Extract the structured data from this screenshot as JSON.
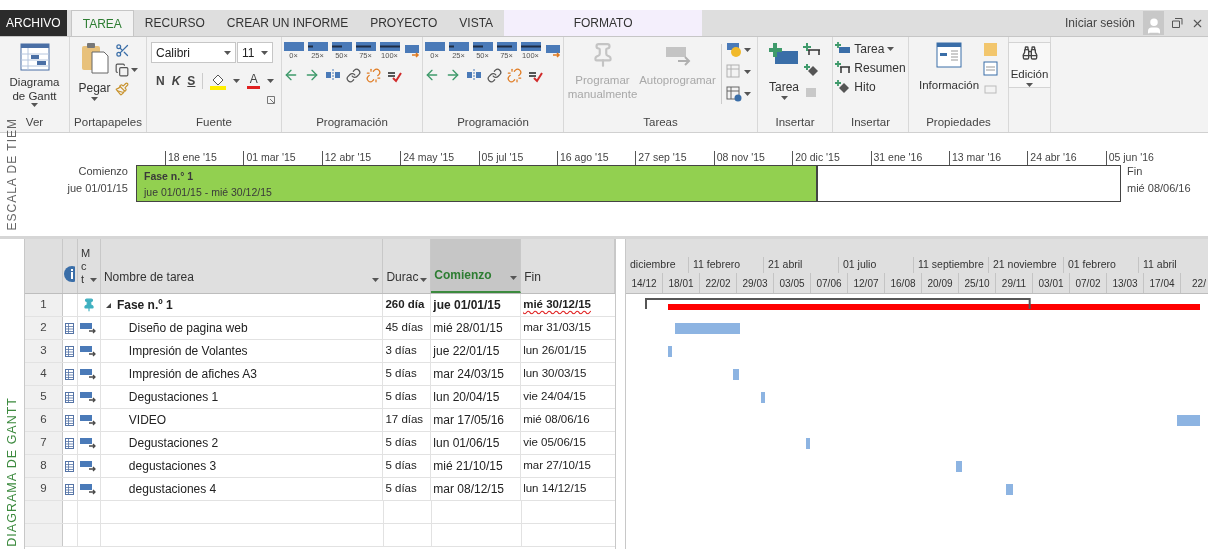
{
  "tabs": [
    {
      "label": "ARCHIVO",
      "kind": "file",
      "selected": false
    },
    {
      "label": "TAREA",
      "kind": "tab",
      "selected": true
    },
    {
      "label": "RECURSO",
      "kind": "tab",
      "selected": false
    },
    {
      "label": "CREAR UN INFORME",
      "kind": "tab",
      "selected": false
    },
    {
      "label": "PROYECTO",
      "kind": "tab",
      "selected": false
    },
    {
      "label": "VISTA",
      "kind": "tab",
      "selected": false
    },
    {
      "label": "FORMATO",
      "kind": "contextual",
      "selected": false
    }
  ],
  "sign_in": "Iniciar sesión",
  "ribbon": [
    {
      "kind": "view",
      "label": "Ver",
      "button": "Diagrama de Gantt"
    },
    {
      "kind": "clipboard",
      "label": "Portapapeles",
      "button": "Pegar"
    },
    {
      "kind": "font",
      "label": "Fuente",
      "font": "Calibri",
      "size": "11",
      "styles": [
        "N",
        "K",
        "S"
      ],
      "color_letter": "A"
    },
    {
      "kind": "schedule",
      "label": "Programación",
      "percents": [
        "0×",
        "25×",
        "50×",
        "75×",
        "100×"
      ]
    },
    {
      "kind": "schedule",
      "label": "Programación",
      "percents": [
        "0×",
        "25×",
        "50×",
        "75×",
        "100×"
      ]
    },
    {
      "kind": "tasks",
      "label": "Tareas",
      "buttons": [
        {
          "label": "Programar manualmente",
          "disabled": true
        },
        {
          "label": "Autoprogramar",
          "disabled": true
        }
      ]
    },
    {
      "kind": "insert_task",
      "label": "Insertar",
      "button": "Tarea"
    },
    {
      "kind": "insert_list",
      "label": "Insertar",
      "items": [
        "Tarea",
        "Resumen",
        "Hito"
      ]
    },
    {
      "kind": "properties",
      "label": "Propiedades",
      "button": "Información"
    },
    {
      "kind": "editing",
      "button": "Edición"
    }
  ],
  "timeline": {
    "side_label": "ESCALA DE TIEM",
    "start_label": "Comienzo",
    "start_date": "jue 01/01/15",
    "ticks": [
      "18 ene '15",
      "01 mar '15",
      "12 abr '15",
      "24 may '15",
      "05 jul '15",
      "16 ago '15",
      "27 sep '15",
      "08 nov '15",
      "20 dic '15",
      "31 ene '16",
      "13 mar '16",
      "24 abr '16",
      "05 jun '16"
    ],
    "bar": {
      "title": "Fase n.° 1",
      "dates": "jue 01/01/15 - mié 30/12/15"
    },
    "end_label": "Fin",
    "end_date": "mié 08/06/16"
  },
  "gantt": {
    "side_label": "DIAGRAMA DE GANTT",
    "columns": [
      {
        "label": "M c t",
        "filter": true,
        "selected": false
      },
      {
        "label": "Nombre de tarea",
        "filter": true,
        "selected": false
      },
      {
        "label": "Durac",
        "filter": true,
        "selected": false
      },
      {
        "label": "Comienzo",
        "filter": true,
        "selected": true
      },
      {
        "label": "Fin",
        "filter": false,
        "selected": false
      }
    ],
    "rows": [
      {
        "id": "1",
        "kind": "summary",
        "expanded": true,
        "name": "Fase n.º 1",
        "duration": "260 día",
        "start": "jue 01/01/15",
        "end": "mié 30/12/15",
        "spell_error": true
      },
      {
        "id": "2",
        "kind": "task",
        "name": "Diseño de pagina web",
        "duration": "45 días",
        "start": "mié 28/01/15",
        "end": "mar 31/03/15",
        "spell_error": false
      },
      {
        "id": "3",
        "kind": "task",
        "name": "Impresión de Volantes",
        "duration": "3 días",
        "start": "jue 22/01/15",
        "end": "lun 26/01/15",
        "spell_error": false
      },
      {
        "id": "4",
        "kind": "task",
        "name": "Impresión de afiches A3",
        "duration": "5 días",
        "start": "mar 24/03/15",
        "end": "lun 30/03/15",
        "spell_error": false
      },
      {
        "id": "5",
        "kind": "task",
        "name": "Degustaciones 1",
        "duration": "5 días",
        "start": "lun 20/04/15",
        "end": "vie 24/04/15",
        "spell_error": false
      },
      {
        "id": "6",
        "kind": "task",
        "name": "VIDEO",
        "duration": "17 días",
        "start": "mar 17/05/16",
        "end": "mié 08/06/16",
        "spell_error": false
      },
      {
        "id": "7",
        "kind": "task",
        "name": "Degustaciones 2",
        "duration": "5 días",
        "start": "lun 01/06/15",
        "end": "vie 05/06/15",
        "spell_error": false
      },
      {
        "id": "8",
        "kind": "task",
        "name": "degustaciones 3",
        "duration": "5 días",
        "start": "mié 21/10/15",
        "end": "mar 27/10/15",
        "spell_error": false
      },
      {
        "id": "9",
        "kind": "task",
        "name": "degustaciones 4",
        "duration": "5 días",
        "start": "mar 08/12/15",
        "end": "lun 14/12/15",
        "spell_error": false
      }
    ],
    "chart_header": {
      "top": [
        "diciembre",
        "11 febrero",
        "21 abril",
        "01 julio",
        "11 septiembre",
        "21 noviembre",
        "01 febrero",
        "11 abril"
      ],
      "bottom": [
        "14/12",
        "18/01",
        "22/02",
        "29/03",
        "03/05",
        "07/06",
        "12/07",
        "16/08",
        "20/09",
        "25/10",
        "29/11",
        "03/01",
        "07/02",
        "13/03",
        "17/04",
        "22/"
      ]
    }
  }
}
